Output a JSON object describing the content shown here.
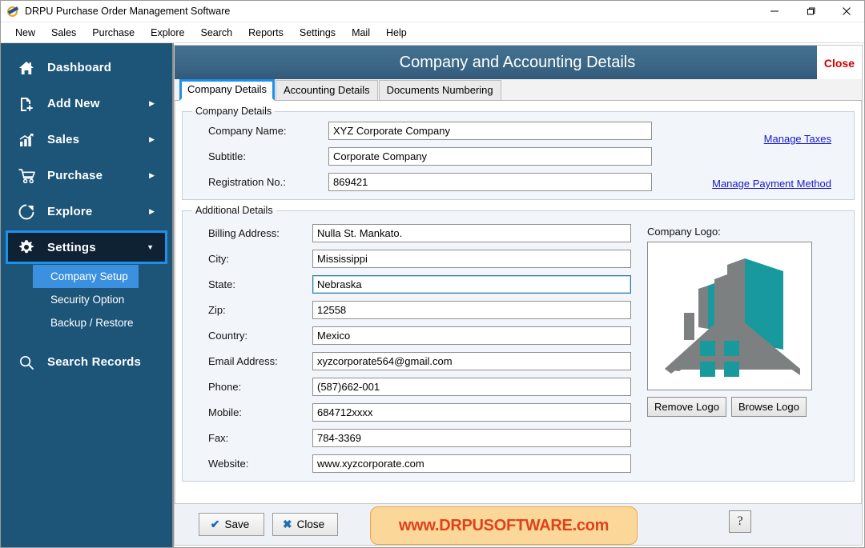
{
  "window": {
    "title": "DRPU Purchase Order Management Software",
    "icon": "app-icon",
    "controls": {
      "minimize": "minimize-icon",
      "maximize": "maximize-icon",
      "close": "close-icon"
    }
  },
  "menubar": {
    "items": [
      "New",
      "Sales",
      "Purchase",
      "Explore",
      "Search",
      "Reports",
      "Settings",
      "Mail",
      "Help"
    ]
  },
  "sidebar": {
    "items": [
      {
        "label": "Dashboard",
        "icon": "home-icon",
        "arrow": "",
        "active": false
      },
      {
        "label": "Add New",
        "icon": "file-plus-icon",
        "arrow": "▶",
        "active": false
      },
      {
        "label": "Sales",
        "icon": "bar-chart-icon",
        "arrow": "▶",
        "active": false
      },
      {
        "label": "Purchase",
        "icon": "shopping-cart-icon",
        "arrow": "▶",
        "active": false
      },
      {
        "label": "Explore",
        "icon": "pie-chart-icon",
        "arrow": "▶",
        "active": false
      },
      {
        "label": "Settings",
        "icon": "gear-icon",
        "arrow": "▼",
        "active": true
      }
    ],
    "submenu": [
      {
        "label": "Company Setup",
        "selected": true
      },
      {
        "label": "Security Option",
        "selected": false
      },
      {
        "label": "Backup / Restore",
        "selected": false
      }
    ],
    "search": {
      "label": "Search Records",
      "icon": "search-icon"
    }
  },
  "panel": {
    "header_title": "Company and Accounting Details",
    "header_close": "Close"
  },
  "tabs": [
    {
      "label": "Company Details",
      "active": true
    },
    {
      "label": "Accounting Details",
      "active": false
    },
    {
      "label": "Documents Numbering",
      "active": false
    }
  ],
  "company_details": {
    "legend": "Company Details",
    "fields": [
      {
        "label": "Company Name:",
        "value": "XYZ Corporate Company",
        "focused": false
      },
      {
        "label": "Subtitle:",
        "value": "Corporate Company",
        "focused": false
      },
      {
        "label": "Registration No.:",
        "value": "869421",
        "focused": false
      }
    ],
    "links": [
      {
        "label": "Manage Taxes"
      },
      {
        "label": "Manage Payment Method"
      }
    ]
  },
  "additional_details": {
    "legend": "Additional Details",
    "fields": [
      {
        "label": "Billing Address:",
        "value": "Nulla St. Mankato.",
        "focused": false
      },
      {
        "label": "City:",
        "value": "Mississippi",
        "focused": false
      },
      {
        "label": "State:",
        "value": "Nebraska",
        "focused": true
      },
      {
        "label": "Zip:",
        "value": "12558",
        "focused": false
      },
      {
        "label": "Country:",
        "value": "Mexico",
        "focused": false
      },
      {
        "label": "Email Address:",
        "value": "xyzcorporate564@gmail.com",
        "focused": false
      },
      {
        "label": "Phone:",
        "value": "(587)662-001",
        "focused": false
      },
      {
        "label": "Mobile:",
        "value": "684712xxxx",
        "focused": false
      },
      {
        "label": "Fax:",
        "value": "784-3369",
        "focused": false
      },
      {
        "label": "Website:",
        "value": "www.xyzcorporate.com",
        "focused": false
      }
    ],
    "logo": {
      "label": "Company Logo:",
      "icon": "house-building-logo-icon",
      "colors": {
        "teal": "#17999e",
        "gray": "#7d8080"
      },
      "buttons": [
        {
          "label": "Remove Logo"
        },
        {
          "label": "Browse Logo"
        }
      ]
    }
  },
  "footer": {
    "save": {
      "label": "Save",
      "icon": "check-icon"
    },
    "close": {
      "label": "Close",
      "icon": "x-icon"
    },
    "watermark": "www.DRPUSOFTWARE.com",
    "help": {
      "label": "?",
      "icon": "help-icon"
    }
  },
  "colors": {
    "sidebar_bg": "#1d5579",
    "sidebar_active_bg": "#0f2234",
    "accent_blue": "#1e90e8",
    "submenu_selected": "#3b91e0",
    "header_blue": "#3c6886",
    "link_blue": "#1818c8",
    "close_red": "#cc0000",
    "watermark_text": "#e0421a",
    "watermark_bg": "#fbd79a",
    "logo_teal": "#17999e",
    "logo_gray": "#7d8080"
  }
}
